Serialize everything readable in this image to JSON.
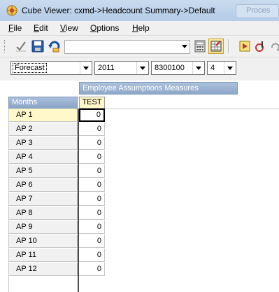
{
  "window": {
    "title": "Cube Viewer: cxmd->Headcount Summary->Default",
    "background_window_text": "Proces"
  },
  "menu": [
    {
      "label": "File",
      "key": "F",
      "rest": "ile"
    },
    {
      "label": "Edit",
      "key": "E",
      "rest": "dit"
    },
    {
      "label": "View",
      "key": "V",
      "rest": "iew"
    },
    {
      "label": "Options",
      "key": "O",
      "rest": "ptions"
    },
    {
      "label": "Help",
      "key": "H",
      "rest": "elp"
    }
  ],
  "toolbar": {
    "buttons": [
      "checkmark-icon",
      "save-icon",
      "recalculate-icon",
      "calculator-icon",
      "grid-options-icon",
      "play-icon",
      "pause-icon",
      "redo-icon"
    ],
    "view_combo_value": ""
  },
  "dimensions": {
    "scenario": "Forecast",
    "year": "2011",
    "account": "8300100",
    "version": "4"
  },
  "grid": {
    "column_dimension_title": "Employee Assumptions Measures",
    "row_dimension_title": "Months",
    "columns": [
      "TEST"
    ],
    "rows": [
      {
        "label": "AP 1",
        "value": "0"
      },
      {
        "label": "AP 2",
        "value": "0"
      },
      {
        "label": "AP 3",
        "value": "0"
      },
      {
        "label": "AP 4",
        "value": "0"
      },
      {
        "label": "AP 5",
        "value": "0"
      },
      {
        "label": "AP 6",
        "value": "0"
      },
      {
        "label": "AP 7",
        "value": "0"
      },
      {
        "label": "AP 8",
        "value": "0"
      },
      {
        "label": "AP 9",
        "value": "0"
      },
      {
        "label": "AP 10",
        "value": "0"
      },
      {
        "label": "AP 11",
        "value": "0"
      },
      {
        "label": "AP 12",
        "value": "0"
      }
    ]
  },
  "colors": {
    "title_bar": "#bcd1ea",
    "header_blue": "#8ea7c8",
    "selected_yellow": "#fff8c8"
  }
}
